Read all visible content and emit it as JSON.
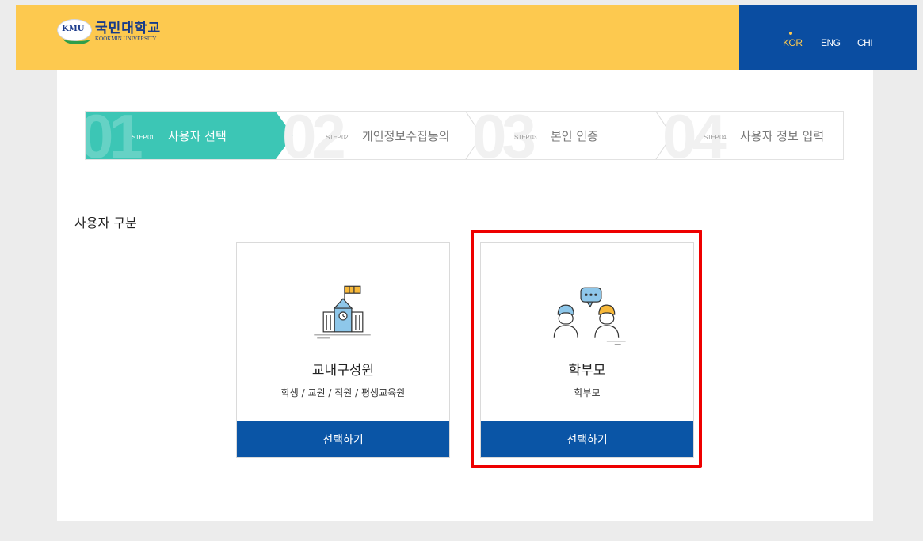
{
  "header": {
    "logo_badge": "KMU",
    "logo_name": "국민대학교",
    "logo_sub": "KOOKMIN UNIVERSITY",
    "languages": [
      {
        "label": "KOR",
        "active": true
      },
      {
        "label": "ENG",
        "active": false
      },
      {
        "label": "CHI",
        "active": false
      }
    ]
  },
  "steps": [
    {
      "big": "01",
      "small": "STEP.01",
      "label": "사용자 선택",
      "active": true
    },
    {
      "big": "02",
      "small": "STEP.02",
      "label": "개인정보수집동의",
      "active": false
    },
    {
      "big": "03",
      "small": "STEP.03",
      "label": "본인 인증",
      "active": false
    },
    {
      "big": "04",
      "small": "STEP.04",
      "label": "사용자 정보 입력",
      "active": false
    }
  ],
  "section": {
    "title": "사용자 구분"
  },
  "cards": [
    {
      "title": "교내구성원",
      "subtitle": "학생 / 교원 / 직원 / 평생교육원",
      "button": "선택하기",
      "icon": "school-building-icon"
    },
    {
      "title": "학부모",
      "subtitle": "학부모",
      "button": "선택하기",
      "icon": "parents-chat-icon"
    }
  ],
  "colors": {
    "header_yellow": "#fdc94f",
    "lang_blue": "#0a4da1",
    "step_active": "#3cc6b5",
    "button_blue": "#0a55a6",
    "highlight_red": "#ee0000"
  }
}
